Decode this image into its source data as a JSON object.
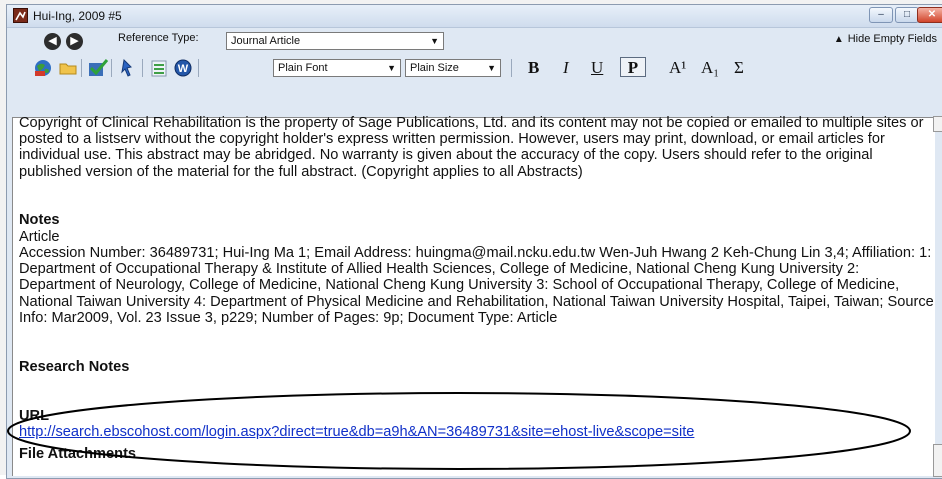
{
  "window": {
    "title": "Hui-Ing, 2009 #5",
    "buttons": {
      "minimize": "–",
      "maximize": "□",
      "close": "✕"
    }
  },
  "toolbar1": {
    "reference_type_label": "Reference Type:",
    "reference_type_value": "Journal Article",
    "hide_empty_fields": "Hide Empty Fields"
  },
  "toolbar2": {
    "font_value": "Plain Font",
    "size_value": "Plain Size",
    "bold": "B",
    "italic": "I",
    "underline": "U",
    "plain": "P",
    "superscript": "A¹",
    "subscript": "A₁",
    "symbol": "Σ"
  },
  "record": {
    "copyright_text": "Copyright of Clinical Rehabilitation is the property of Sage Publications, Ltd. and its content may not be copied or emailed to multiple sites or posted to a listserv without the copyright holder's express written permission. However, users may print, download, or email articles for individual use. This abstract may be abridged. No warranty is given about the accuracy of the copy. Users should refer to the original published version of the material for the full abstract. (Copyright applies to all Abstracts)",
    "notes_heading": "Notes",
    "notes_type": "Article",
    "notes_body": "Accession Number: 36489731; Hui-Ing Ma 1; Email Address: huingma@mail.ncku.edu.tw Wen-Juh Hwang 2 Keh-Chung Lin 3,4; Affiliation: 1: Department of Occupational Therapy & Institute of Allied Health Sciences, College of Medicine, National Cheng Kung University 2: Department of Neurology, College of Medicine, National Cheng Kung University 3: School of Occupational Therapy, College of Medicine, National Taiwan University 4: Department of Physical Medicine and Rehabilitation, National Taiwan University Hospital, Taipei, Taiwan; Source Info: Mar2009, Vol. 23 Issue 3, p229; Number of Pages: 9p; Document Type: Article",
    "research_notes_heading": "Research Notes",
    "url_heading": "URL",
    "url_value": "http://search.ebscohost.com/login.aspx?direct=true&db=a9h&AN=36489731&site=ehost-live&scope=site",
    "file_attachments_heading": "File Attachments"
  },
  "icons": [
    "app-icon",
    "back-arrow-icon",
    "forward-arrow-icon",
    "globe-icon",
    "folder-icon",
    "checkmark-icon",
    "pointer-icon",
    "list-icon",
    "word-icon",
    "up-arrow-icon"
  ],
  "colors": {
    "link": "#1030c8",
    "titlebar": "#dfe8f3",
    "close": "#d1442b"
  }
}
